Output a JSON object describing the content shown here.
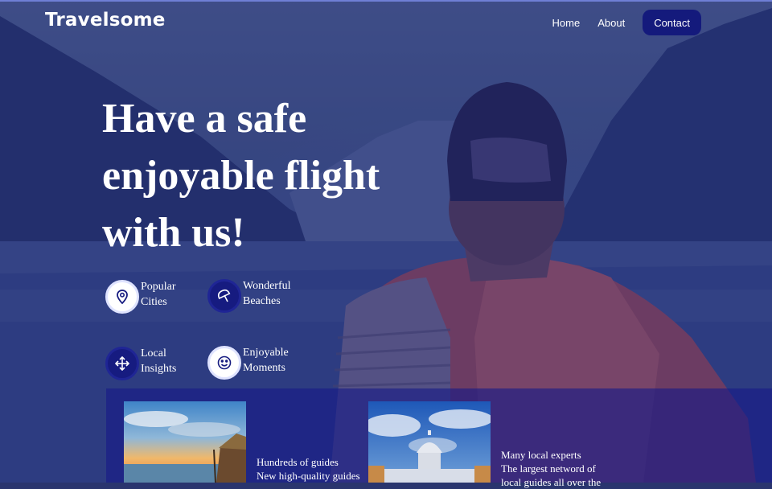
{
  "brand": {
    "logo": "Travelsome"
  },
  "nav": {
    "home": "Home",
    "about": "About",
    "contact": "Contact"
  },
  "hero": {
    "headline_line1": "Have a safe",
    "headline_line2": "enjoyable flight",
    "headline_line3": "with us!"
  },
  "features": [
    {
      "line1": "Popular",
      "line2": "Cities",
      "icon": "map-pin-icon"
    },
    {
      "line1": "Wonderful",
      "line2": "Beaches",
      "icon": "umbrella-icon"
    },
    {
      "line1": "Local",
      "line2": "Insights",
      "icon": "move-arrows-icon"
    },
    {
      "line1": "Enjoyable",
      "line2": "Moments",
      "icon": "smile-icon"
    }
  ],
  "cards": [
    {
      "line1": "Hundreds of guides",
      "line2": "New high-quality guides"
    },
    {
      "line1": "Many local experts",
      "line2": "The largest netword of",
      "line3": "local guides all over the"
    }
  ],
  "colors": {
    "overlay": "#182278",
    "accent_dark": "#141a7c",
    "text": "#ffffff"
  }
}
